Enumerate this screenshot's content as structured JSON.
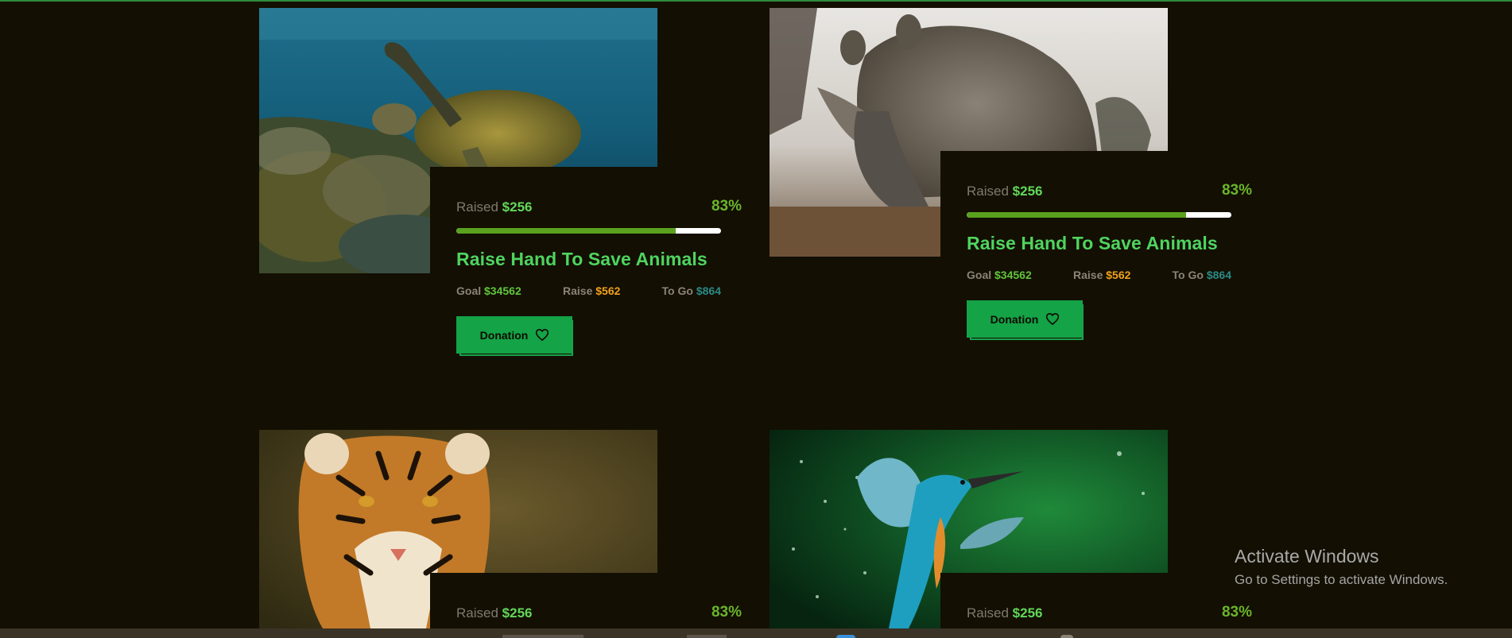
{
  "cards": [
    {
      "name": "turtle",
      "image_icon": "sea-turtle-photo",
      "raised_label": "Raised",
      "raised_amount": "$256",
      "percent": "83%",
      "progress": 0.83,
      "title": "Raise Hand To Save Animals",
      "goal_label": "Goal",
      "goal_value": "$34562",
      "raise_label": "Raise",
      "raise_value": "$562",
      "togo_label": "To Go",
      "togo_value": "$864",
      "button_label": "Donation"
    },
    {
      "name": "rhino",
      "image_icon": "rhino-photo",
      "raised_label": "Raised",
      "raised_amount": "$256",
      "percent": "83%",
      "progress": 0.83,
      "title": "Raise Hand To Save Animals",
      "goal_label": "Goal",
      "goal_value": "$34562",
      "raise_label": "Raise",
      "raise_value": "$562",
      "togo_label": "To Go",
      "togo_value": "$864",
      "button_label": "Donation"
    },
    {
      "name": "tiger",
      "image_icon": "tiger-photo",
      "raised_label": "Raised",
      "raised_amount": "$256",
      "percent": "83%",
      "progress": 0.83
    },
    {
      "name": "kingfisher",
      "image_icon": "kingfisher-photo",
      "raised_label": "Raised",
      "raised_amount": "$256",
      "percent": "83%",
      "progress": 0.83
    }
  ],
  "watermark": {
    "title": "Activate Windows",
    "subtitle": "Go to Settings to activate Windows."
  },
  "colors": {
    "background": "#130f02",
    "accent_green": "#4fd45f",
    "button_green": "#14a347",
    "raise_orange": "#f0a11a",
    "togo_teal": "#2a8a86"
  }
}
